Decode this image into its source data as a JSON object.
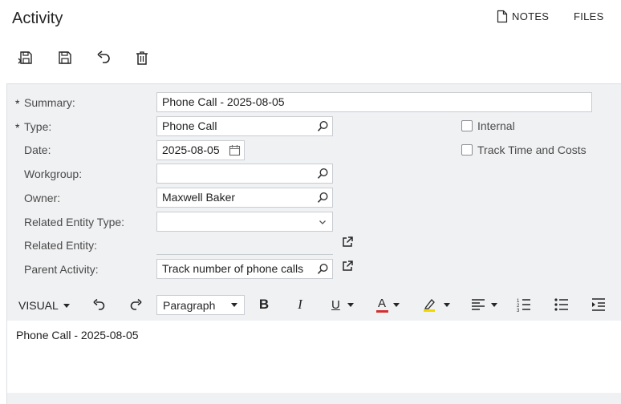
{
  "page": {
    "title": "Activity"
  },
  "header_links": {
    "notes": "NOTES",
    "files": "FILES"
  },
  "toolbar": {
    "icons": [
      "save-close-icon",
      "save-icon",
      "undo-icon",
      "delete-icon"
    ]
  },
  "form": {
    "required_marker": "*",
    "summary": {
      "label": "Summary:",
      "value": "Phone Call - 2025-08-05"
    },
    "type": {
      "label": "Type:",
      "value": "Phone Call"
    },
    "date": {
      "label": "Date:",
      "value": "2025-08-05"
    },
    "workgroup": {
      "label": "Workgroup:",
      "value": ""
    },
    "owner": {
      "label": "Owner:",
      "value": "Maxwell Baker"
    },
    "related_entity_type": {
      "label": "Related Entity Type:",
      "value": ""
    },
    "related_entity": {
      "label": "Related Entity:",
      "value": ""
    },
    "parent_activity": {
      "label": "Parent Activity:",
      "value": "Track number of phone calls"
    },
    "internal": {
      "label": "Internal",
      "checked": false
    },
    "track_time": {
      "label": "Track Time and Costs",
      "checked": false
    }
  },
  "editor_toolbar": {
    "mode": "VISUAL",
    "paragraph": "Paragraph",
    "bold": "B",
    "italic": "I",
    "underline": "U",
    "font_color": "A",
    "font_color_bar": "#d32f2f",
    "highlight_bar": "#f2d600"
  },
  "editor": {
    "content": "Phone Call - 2025-08-05"
  }
}
